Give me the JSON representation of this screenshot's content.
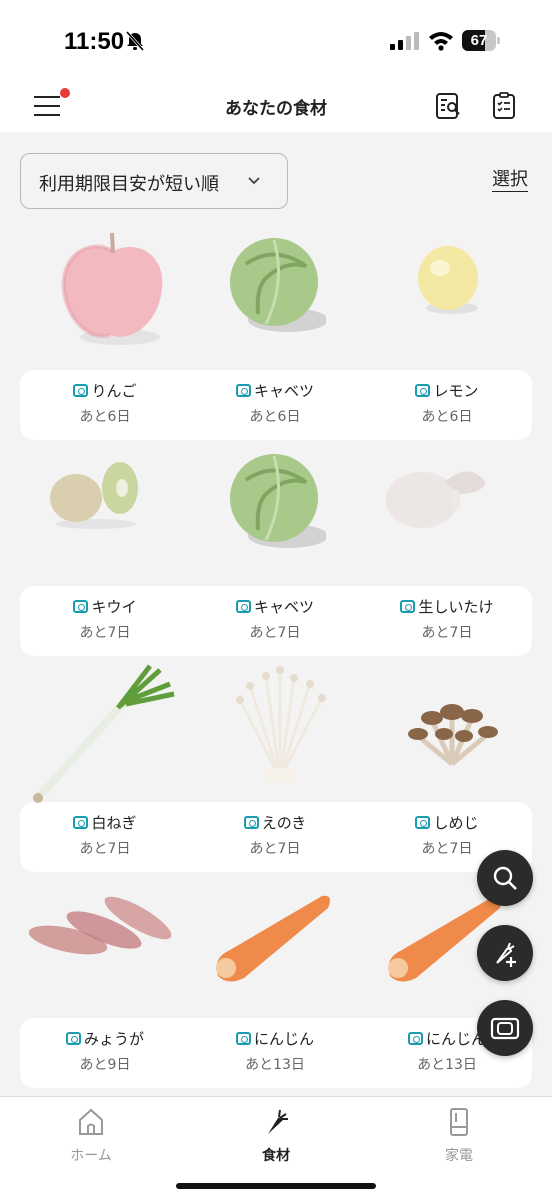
{
  "status_bar": {
    "time": "11:50",
    "battery_level": "67",
    "battery_fraction": 0.67
  },
  "header": {
    "title": "あなたの食材",
    "menu_has_notification": true
  },
  "toolbar": {
    "sort_label": "利用期限目安が短い順",
    "select_label": "選択"
  },
  "foods": [
    {
      "name": "りんご",
      "days": "あと6日",
      "icon": "apple"
    },
    {
      "name": "キャベツ",
      "days": "あと6日",
      "icon": "cabbage"
    },
    {
      "name": "レモン",
      "days": "あと6日",
      "icon": "lemon"
    },
    {
      "name": "キウイ",
      "days": "あと7日",
      "icon": "kiwi"
    },
    {
      "name": "キャベツ",
      "days": "あと7日",
      "icon": "cabbage"
    },
    {
      "name": "生しいたけ",
      "days": "あと7日",
      "icon": "shiitake"
    },
    {
      "name": "白ねぎ",
      "days": "あと7日",
      "icon": "leek"
    },
    {
      "name": "えのき",
      "days": "あと7日",
      "icon": "enoki"
    },
    {
      "name": "しめじ",
      "days": "あと7日",
      "icon": "shimeji"
    },
    {
      "name": "みょうが",
      "days": "あと9日",
      "icon": "myoga"
    },
    {
      "name": "にんじん",
      "days": "あと13日",
      "icon": "carrot"
    },
    {
      "name": "にんじん",
      "days": "あと13日",
      "icon": "carrot"
    }
  ],
  "fabs": [
    "search-icon",
    "add-ingredient-icon",
    "camera-icon"
  ],
  "tabs": [
    {
      "label": "ホーム",
      "icon": "home-icon",
      "active": false
    },
    {
      "label": "食材",
      "icon": "carrot-icon",
      "active": true
    },
    {
      "label": "家電",
      "icon": "fridge-icon",
      "active": false
    }
  ],
  "colors": {
    "accent_teal": "#1a9bb0",
    "notification_red": "#e53935",
    "fab_dark": "#2b2b2b"
  }
}
